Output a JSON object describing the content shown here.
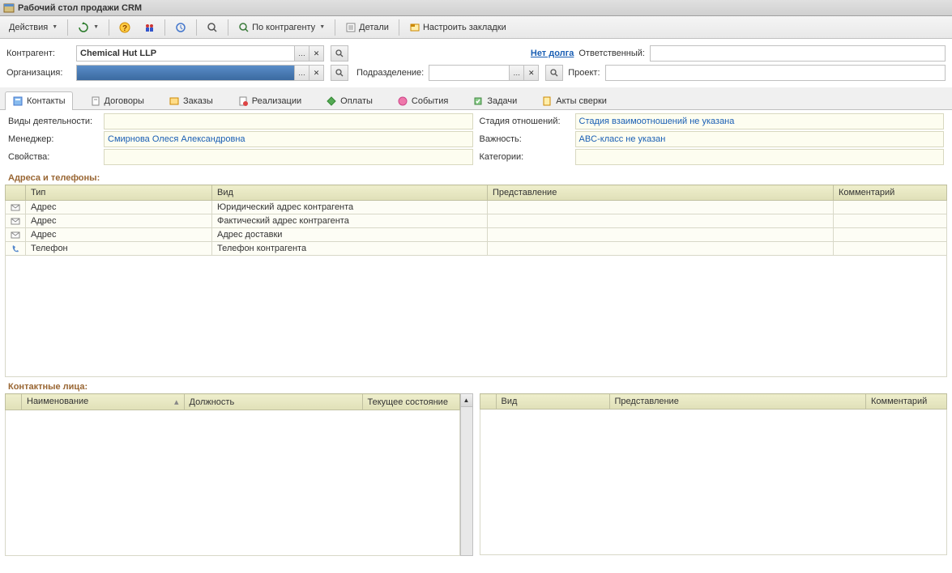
{
  "window": {
    "title": "Рабочий стол продажи CRM"
  },
  "toolbar": {
    "actions": "Действия",
    "by_counterparty": "По контрагенту",
    "details": "Детали",
    "customize_tabs": "Настроить закладки"
  },
  "form": {
    "counterparty_label": "Контрагент:",
    "counterparty_value": "Chemical Hut LLP",
    "organization_label": "Организация:",
    "organization_value": "",
    "subdivision_label": "Подразделение:",
    "subdivision_value": "",
    "no_debt": "Нет долга",
    "responsible_label": "Ответственный:",
    "responsible_value": "",
    "project_label": "Проект:",
    "project_value": ""
  },
  "tabs": [
    "Контакты",
    "Договоры",
    "Заказы",
    "Реализации",
    "Оплаты",
    "События",
    "Задачи",
    "Акты сверки"
  ],
  "details": {
    "activity_types_label": "Виды деятельности:",
    "activity_types_value": "",
    "stage_label": "Стадия отношений:",
    "stage_value": "Стадия взаимоотношений не указана",
    "manager_label": "Менеджер:",
    "manager_value": "Смирнова Олеся Александровна",
    "importance_label": "Важность:",
    "importance_value": "ABC-класс не указан",
    "properties_label": "Свойства:",
    "properties_value": "",
    "categories_label": "Категории:",
    "categories_value": ""
  },
  "sections": {
    "addresses": "Адреса и телефоны:",
    "contacts": "Контактные лица:"
  },
  "addr_table": {
    "headers": [
      "Тип",
      "Вид",
      "Представление",
      "Комментарий"
    ],
    "rows": [
      [
        "Адрес",
        "Юридический адрес контрагента",
        "",
        ""
      ],
      [
        "Адрес",
        "Фактический адрес контрагента",
        "",
        ""
      ],
      [
        "Адрес",
        "Адрес доставки",
        "",
        ""
      ],
      [
        "Телефон",
        "Телефон контрагента",
        "",
        ""
      ]
    ]
  },
  "contacts_table": {
    "left_headers": [
      "Наименование",
      "Должность",
      "Текущее состояние"
    ],
    "right_headers": [
      "Вид",
      "Представление",
      "Комментарий"
    ]
  }
}
